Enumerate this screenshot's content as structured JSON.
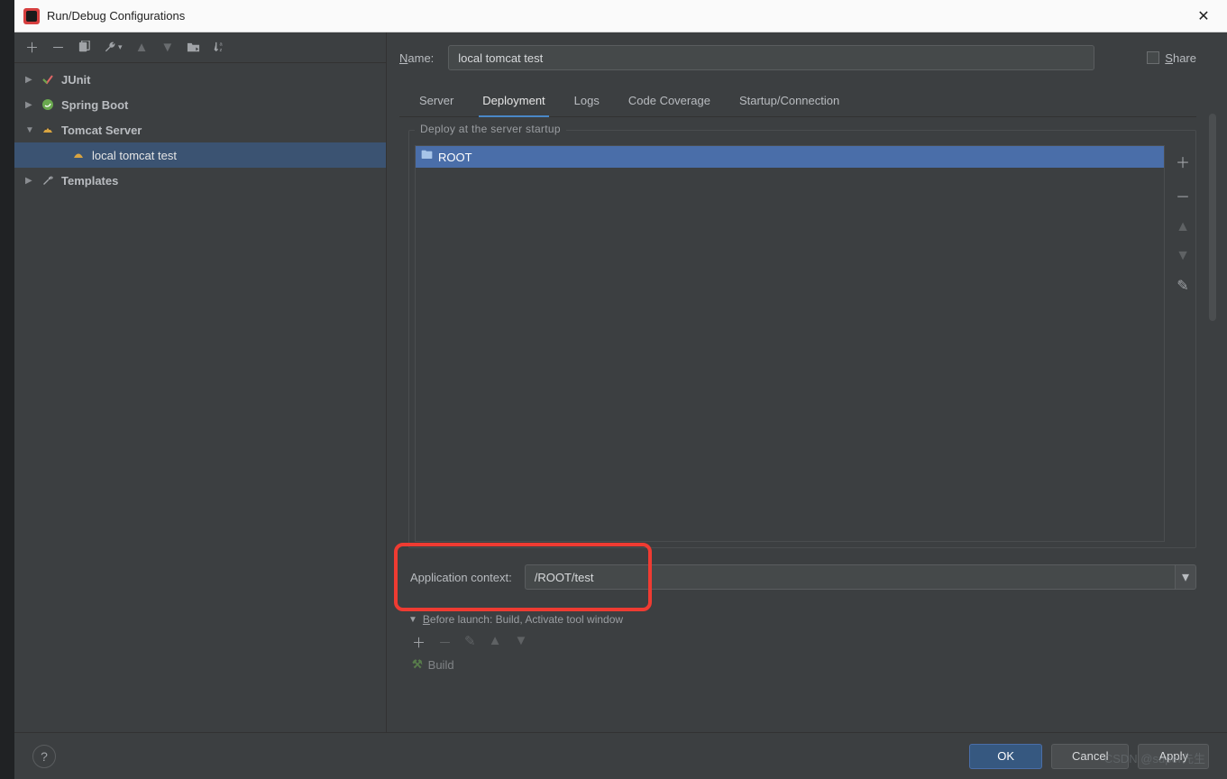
{
  "window": {
    "title": "Run/Debug Configurations"
  },
  "sidebar": {
    "items": [
      {
        "label": "JUnit"
      },
      {
        "label": "Spring Boot"
      },
      {
        "label": "Tomcat Server"
      },
      {
        "label": "local tomcat test"
      },
      {
        "label": "Templates"
      }
    ]
  },
  "name_row": {
    "label_pre": "N",
    "label_rest": "ame:",
    "value": "local tomcat test"
  },
  "share": {
    "label_pre": "S",
    "label_rest": "hare"
  },
  "tabs": {
    "server": "Server",
    "deployment": "Deployment",
    "logs": "Logs",
    "coverage": "Code Coverage",
    "startup": "Startup/Connection"
  },
  "deploy": {
    "legend": "Deploy at the server startup",
    "items": [
      {
        "label": "ROOT"
      }
    ]
  },
  "app_context": {
    "label": "Application context:",
    "value": "/ROOT/test"
  },
  "before_launch": {
    "label_pre": "B",
    "label_rest": "efore launch: Build, Activate tool window",
    "task": "Build"
  },
  "footer": {
    "ok": "OK",
    "cancel": "Cancel",
    "apply": "Apply"
  },
  "watermark": "CSDN @super先生"
}
